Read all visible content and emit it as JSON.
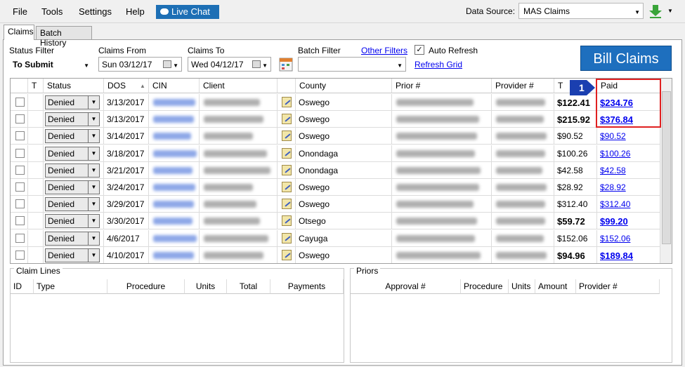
{
  "menu": {
    "file": "File",
    "tools": "Tools",
    "settings": "Settings",
    "help": "Help",
    "live_chat": "Live Chat"
  },
  "data_source": {
    "label": "Data Source:",
    "value": "MAS Claims"
  },
  "tabs": {
    "claims": "Claims",
    "batch_history": "Batch History"
  },
  "filters": {
    "status_label": "Status Filter",
    "status_value": "To Submit",
    "from_label": "Claims From",
    "from_value": "Sun  03/12/17",
    "to_label": "Claims To",
    "to_value": "Wed 04/12/17",
    "batch_label": "Batch Filter",
    "batch_value": "",
    "other_filters": "Other Filters",
    "auto_refresh": "Auto Refresh",
    "refresh_grid": "Refresh Grid"
  },
  "bill_claims": "Bill Claims",
  "marker_number": "1",
  "columns": {
    "t": "T",
    "status": "Status",
    "dos": "DOS",
    "cin": "CIN",
    "client": "Client",
    "county": "County",
    "prior": "Prior #",
    "provider": "Provider #",
    "total": "T",
    "paid": "Paid"
  },
  "rows": [
    {
      "status": "Denied",
      "dos": "3/13/2017",
      "county": "Oswego",
      "total": "$122.41",
      "paid": "$234.76",
      "bold": true
    },
    {
      "status": "Denied",
      "dos": "3/13/2017",
      "county": "Oswego",
      "total": "$215.92",
      "paid": "$376.84",
      "bold": true
    },
    {
      "status": "Denied",
      "dos": "3/14/2017",
      "county": "Oswego",
      "total": "$90.52",
      "paid": "$90.52",
      "bold": false
    },
    {
      "status": "Denied",
      "dos": "3/18/2017",
      "county": "Onondaga",
      "total": "$100.26",
      "paid": "$100.26",
      "bold": false
    },
    {
      "status": "Denied",
      "dos": "3/21/2017",
      "county": "Onondaga",
      "total": "$42.58",
      "paid": "$42.58",
      "bold": false
    },
    {
      "status": "Denied",
      "dos": "3/24/2017",
      "county": "Oswego",
      "total": "$28.92",
      "paid": "$28.92",
      "bold": false
    },
    {
      "status": "Denied",
      "dos": "3/29/2017",
      "county": "Oswego",
      "total": "$312.40",
      "paid": "$312.40",
      "bold": false
    },
    {
      "status": "Denied",
      "dos": "3/30/2017",
      "county": "Otsego",
      "total": "$59.72",
      "paid": "$99.20",
      "bold": true
    },
    {
      "status": "Denied",
      "dos": "4/6/2017",
      "county": "Cayuga",
      "total": "$152.06",
      "paid": "$152.06",
      "bold": false
    },
    {
      "status": "Denied",
      "dos": "4/10/2017",
      "county": "Oswego",
      "total": "$94.96",
      "paid": "$189.84",
      "bold": true
    }
  ],
  "claim_lines": {
    "title": "Claim Lines",
    "columns": [
      "ID",
      "Type",
      "Procedure",
      "Units",
      "Total",
      "Payments"
    ]
  },
  "priors": {
    "title": "Priors",
    "columns": [
      "Approval #",
      "Procedure",
      "Units",
      "Amount",
      "Provider #"
    ]
  },
  "colors": {
    "accent": "#1e6fbe",
    "highlight": "#e02020",
    "link": "#0000ee"
  }
}
